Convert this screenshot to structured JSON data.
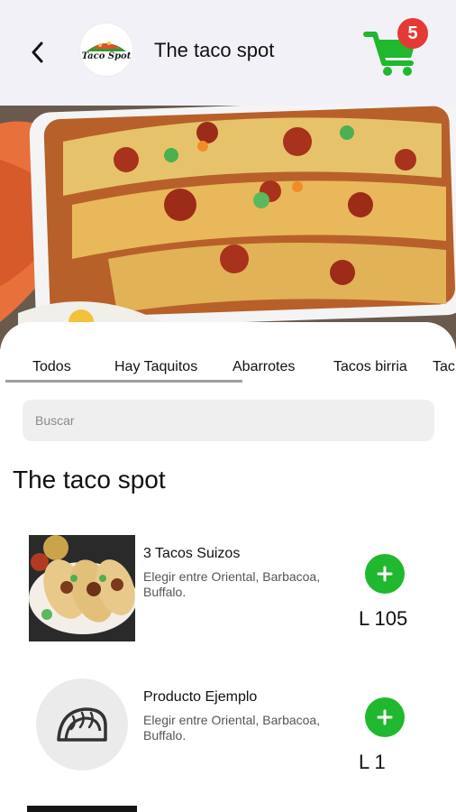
{
  "header": {
    "store_title": "The taco spot",
    "logo_text": "Taco Spot",
    "cart_count": "5"
  },
  "tabs": [
    {
      "label": "Todos"
    },
    {
      "label": "Hay Taquitos"
    },
    {
      "label": "Abarrotes"
    },
    {
      "label": "Tacos birria"
    },
    {
      "label": "Tac"
    }
  ],
  "search": {
    "placeholder": "Buscar"
  },
  "section": {
    "title": "The taco spot"
  },
  "products": [
    {
      "name": "3 Tacos Suizos",
      "description": "Elegir entre Oriental, Barbacoa, Buffalo.",
      "price": "L 105",
      "image": "tacos-photo"
    },
    {
      "name": "Producto Ejemplo",
      "description": "Elegir entre Oriental, Barbacoa, Buffalo.",
      "price": "L 1",
      "image": "taco-placeholder-icon"
    }
  ],
  "colors": {
    "header_bg": "#f2f1f7",
    "accent_green": "#1fb82e",
    "badge_red": "#e53935",
    "search_bg": "#efefef"
  }
}
